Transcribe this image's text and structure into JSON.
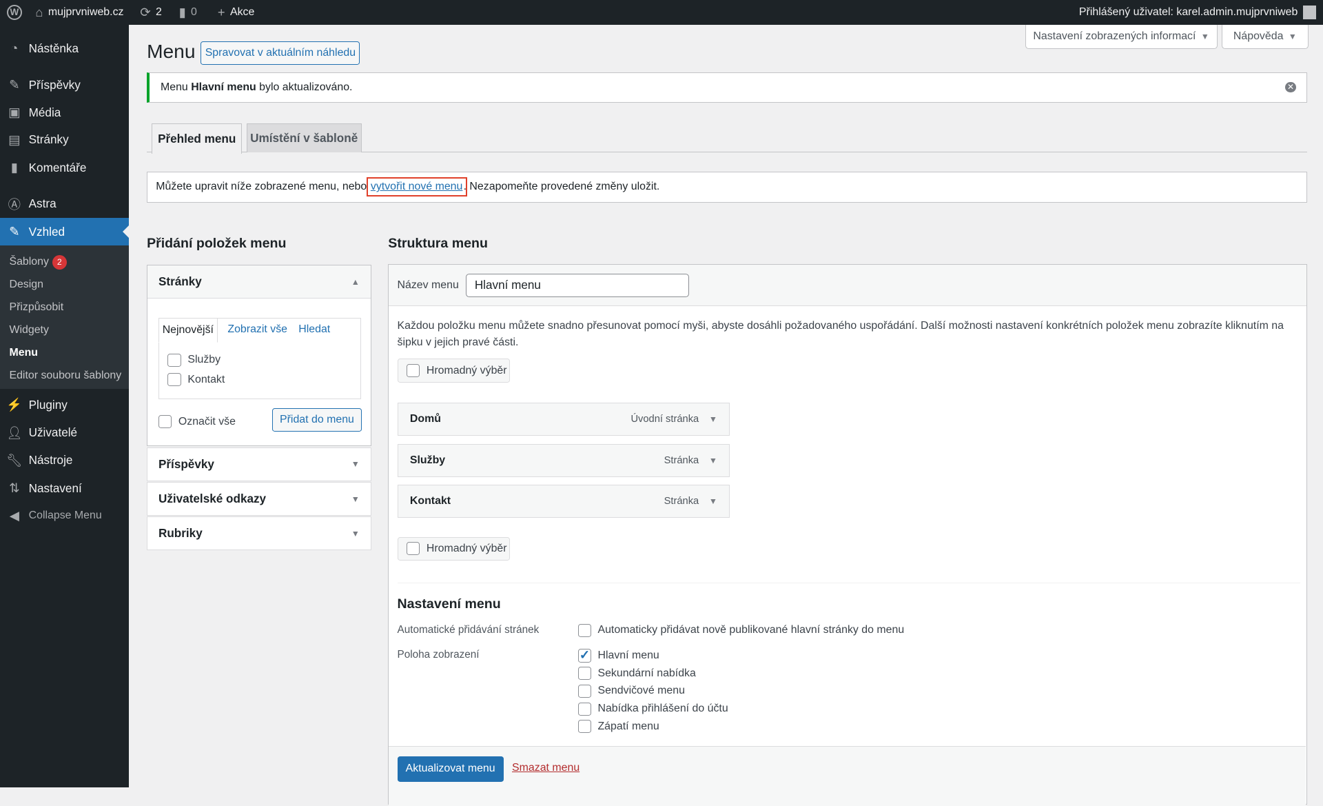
{
  "topbar": {
    "site": "mujprvniweb.cz",
    "updates": "2",
    "comments": "0",
    "new": "Akce",
    "user": "Přihlášený uživatel: karel.admin.mujprvniweb"
  },
  "sidebar": {
    "items": [
      {
        "label": "Nástěnka"
      },
      {
        "label": "Příspěvky"
      },
      {
        "label": "Média"
      },
      {
        "label": "Stránky"
      },
      {
        "label": "Komentáře"
      },
      {
        "label": "Astra"
      },
      {
        "label": "Vzhled"
      },
      {
        "label": "Pluginy"
      },
      {
        "label": "Uživatelé"
      },
      {
        "label": "Nástroje"
      },
      {
        "label": "Nastavení"
      },
      {
        "label": "Collapse Menu"
      }
    ],
    "submenu": [
      {
        "label": "Šablony",
        "badge": "2"
      },
      {
        "label": "Design"
      },
      {
        "label": "Přizpůsobit"
      },
      {
        "label": "Widgety"
      },
      {
        "label": "Menu"
      },
      {
        "label": "Editor souboru šablony"
      }
    ]
  },
  "header": {
    "screen_options": "Nastavení zobrazených informací",
    "help": "Nápověda",
    "title": "Menu",
    "manage_live": "Spravovat v aktuálním náhledu"
  },
  "notice": {
    "prefix": "Menu ",
    "name": "Hlavní menu",
    "suffix": " bylo aktualizováno."
  },
  "tabs": [
    {
      "label": "Přehled menu"
    },
    {
      "label": "Umístění v šabloně"
    }
  ],
  "info": {
    "prefix": "Můžete upravit níže zobrazené menu, nebo ",
    "link": "vytvořit nové menu",
    "suffix": ". Nezapomeňte provedené změny uložit."
  },
  "add_items": {
    "title": "Přidání položek menu",
    "pages": {
      "title": "Stránky",
      "tabs": [
        "Nejnovější",
        "Zobrazit vše",
        "Hledat"
      ],
      "items": [
        "Služby",
        "Kontakt"
      ],
      "select_all": "Označit vše",
      "add_button": "Přidat do menu"
    },
    "sections": [
      "Příspěvky",
      "Uživatelské odkazy",
      "Rubriky"
    ]
  },
  "structure": {
    "title": "Struktura menu",
    "name_label": "Název menu",
    "name_value": "Hlavní menu",
    "description": "Každou položku menu můžete snadno přesunovat pomocí myši, abyste dosáhli požadovaného uspořádání. Další možnosti nastavení konkrétních položek menu zobrazíte kliknutím na šipku v jejich pravé části.",
    "bulk": "Hromadný výběr",
    "items": [
      {
        "title": "Domů",
        "type": "Úvodní stránka"
      },
      {
        "title": "Služby",
        "type": "Stránka"
      },
      {
        "title": "Kontakt",
        "type": "Stránka"
      }
    ]
  },
  "settings": {
    "title": "Nastavení menu",
    "auto_label": "Automatické přidávání stránek",
    "auto_option": "Automaticky přidávat nově publikované hlavní stránky do menu",
    "location_label": "Poloha zobrazení",
    "locations": [
      {
        "label": "Hlavní menu",
        "checked": true
      },
      {
        "label": "Sekundární nabídka",
        "checked": false
      },
      {
        "label": "Sendvičové menu",
        "checked": false
      },
      {
        "label": "Nabídka přihlášení do účtu",
        "checked": false
      },
      {
        "label": "Zápatí menu",
        "checked": false
      }
    ]
  },
  "footer": {
    "save": "Aktualizovat menu",
    "delete": "Smazat menu"
  }
}
